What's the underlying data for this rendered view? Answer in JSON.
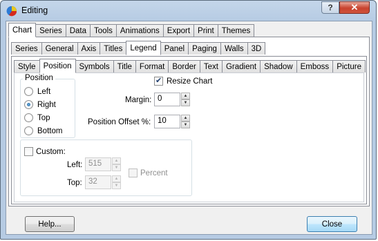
{
  "window": {
    "title": "Editing",
    "help_glyph": "?",
    "close_glyph": "✕"
  },
  "tabs_level1": [
    "Chart",
    "Series",
    "Data",
    "Tools",
    "Animations",
    "Export",
    "Print",
    "Themes"
  ],
  "tabs_level2": [
    "Series",
    "General",
    "Axis",
    "Titles",
    "Legend",
    "Panel",
    "Paging",
    "Walls",
    "3D"
  ],
  "tabs_level3": [
    "Style",
    "Position",
    "Symbols",
    "Title",
    "Format",
    "Border",
    "Text",
    "Gradient",
    "Shadow",
    "Emboss",
    "Picture"
  ],
  "position_group": {
    "title": "Position",
    "options": [
      "Left",
      "Right",
      "Top",
      "Bottom"
    ],
    "selected": "Right"
  },
  "resize_chart": {
    "label": "Resize Chart",
    "checked": true
  },
  "margin": {
    "label": "Margin:",
    "value": "0"
  },
  "position_offset": {
    "label": "Position Offset %:",
    "value": "10"
  },
  "custom": {
    "label": "Custom:",
    "checked": false,
    "left_label": "Left:",
    "left_value": "515",
    "top_label": "Top:",
    "top_value": "32",
    "percent_label": "Percent"
  },
  "buttons": {
    "help": "Help...",
    "close": "Close"
  }
}
